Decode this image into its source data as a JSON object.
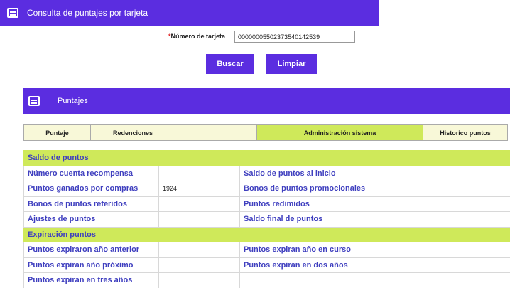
{
  "header": {
    "title": "Consulta de puntajes por tarjeta",
    "icon": "document-icon"
  },
  "search": {
    "required_mark": "*",
    "card_label": "Número de tarjeta",
    "card_value": "0000000550237354014253​9"
  },
  "buttons": {
    "search": "Buscar",
    "clear": "Limpiar"
  },
  "section": {
    "title": "Puntajes",
    "icon": "document-icon"
  },
  "tabs": [
    "Puntaje",
    "Redenciones",
    "Administración sistema",
    "Historico puntos"
  ],
  "active_tab": "Administración sistema",
  "table": {
    "group1": "Saldo de puntos",
    "rows1": [
      {
        "l1": "Número cuenta recompensa",
        "v1": "",
        "l2": "Saldo de puntos al inicio",
        "v2": ""
      },
      {
        "l1": "Puntos ganados por compras",
        "v1": "1924",
        "l2": "Bonos de puntos promocionales",
        "v2": ""
      },
      {
        "l1": "Bonos de puntos referidos",
        "v1": "",
        "l2": "Puntos redimidos",
        "v2": ""
      },
      {
        "l1": "Ajustes de puntos",
        "v1": "",
        "l2": "Saldo final de puntos",
        "v2": ""
      }
    ],
    "group2": "Expiración puntos",
    "rows2": [
      {
        "l1": "Puntos expiraron año anterior",
        "v1": "",
        "l2": "Puntos expiran año en curso",
        "v2": ""
      },
      {
        "l1": "Puntos expiran año próximo",
        "v1": "",
        "l2": "Puntos expiran en dos años",
        "v2": ""
      },
      {
        "l1": "Puntos expiran en tres años",
        "v1": "",
        "l2": "",
        "v2": ""
      }
    ]
  },
  "colors": {
    "primary": "#5b2de0",
    "accent": "#cfe95a",
    "label_text": "#3f3fbf"
  }
}
